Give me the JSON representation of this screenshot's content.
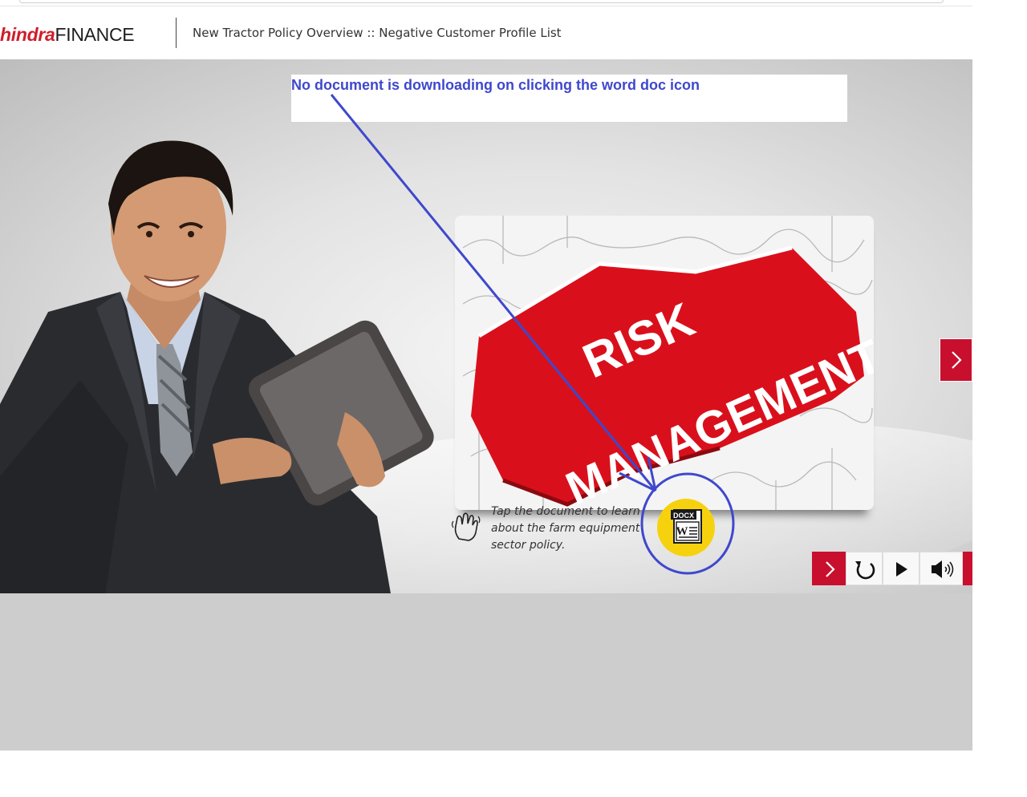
{
  "header": {
    "logo_brand": "hindra",
    "logo_finance": "FINANCE",
    "page_title": "New Tractor Policy Overview :: Negative Customer Profile List"
  },
  "annotation": {
    "note": "No document is downloading on clicking the word doc icon",
    "color": "#3f48cc"
  },
  "slide": {
    "image_risk_word1": "RISK",
    "image_risk_word2": "MANAGEMENT",
    "instruction": "Tap the document to learn about the farm equipment sector policy.",
    "doc_icon_label": "DOCX",
    "doc_icon_letter": "W",
    "accent_color": "#c8102e",
    "doc_button_color": "#f6d20e"
  },
  "controls": {
    "icons": [
      "next-icon",
      "replay-icon",
      "play-icon",
      "audio-icon"
    ]
  }
}
